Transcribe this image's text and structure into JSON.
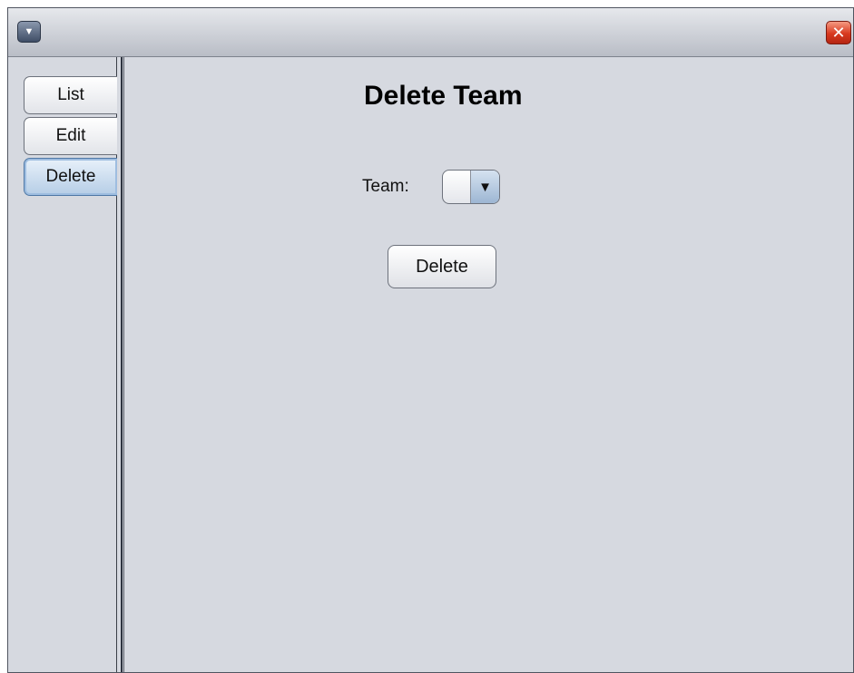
{
  "window": {
    "menu_icon": "chevron-down-icon",
    "close_icon": "close-icon"
  },
  "tabs": [
    {
      "label": "List",
      "selected": false
    },
    {
      "label": "Edit",
      "selected": false
    },
    {
      "label": "Delete",
      "selected": true
    }
  ],
  "panel": {
    "title": "Delete Team",
    "team_label": "Team:",
    "team_value": "",
    "delete_button": "Delete"
  },
  "colors": {
    "window_bg": "#d6d9e0",
    "selected_tab": "#b5cde6",
    "close_button": "#d8391f"
  }
}
